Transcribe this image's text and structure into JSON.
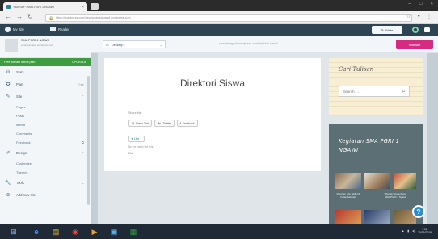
{
  "browser": {
    "tab_title": "Your Site ‹ SMA PGRI 1 NGAWI",
    "url": "https://wordpress.com/view/smanisangawi.wordpress.com"
  },
  "admin_bar": {
    "my_site": "My Site",
    "reader": "Reader",
    "write": "Write"
  },
  "sidebar": {
    "site_name": "SMA PGRI 1 NGAWI",
    "site_url": "smanisangawi.wordpress.com",
    "free_domain": "Free domain with a plan",
    "upgrade": "UPGRADE",
    "menu": [
      {
        "label": "Stats",
        "icon": "stats-icon",
        "right": ""
      },
      {
        "label": "Plan",
        "icon": "plan-icon",
        "right": "Free"
      },
      {
        "label": "Site",
        "icon": "pencil-icon",
        "right": "^"
      }
    ],
    "site_sub": [
      "Pages",
      "Posts",
      "Media",
      "Comments",
      "Feedback"
    ],
    "design": {
      "label": "Design",
      "icon": "design-icon",
      "right": "^"
    },
    "design_sub": [
      "Customize",
      "Themes"
    ],
    "tools": {
      "label": "Tools",
      "icon": "tools-icon",
      "right": "v"
    },
    "add_site": "Add new site"
  },
  "preview": {
    "device": "Desktop",
    "url": "smanisangawi.wordpress.com/direktori-siswa/",
    "visit_site": "Visit site"
  },
  "post": {
    "title": "Direktori Siswa",
    "share_label": "Share this:",
    "share_buttons": [
      "Press This",
      "Twitter",
      "Facebook"
    ],
    "like": "Like",
    "like_note": "Be the first to like this.",
    "edit": "Edit"
  },
  "search_widget": {
    "title": "Cari Tulisan",
    "placeholder": "Search …"
  },
  "kegiatan_widget": {
    "title": "Kegiatan SMA PGRI 1 NGAWI",
    "captions": [
      "Program Life Skills Di Kelas Sebelas",
      "Wisuda Siswa-Siswi SMA PGRI 1 Ngawi"
    ]
  },
  "taskbar": {
    "time": "7:06",
    "date": "20/06/2019"
  }
}
